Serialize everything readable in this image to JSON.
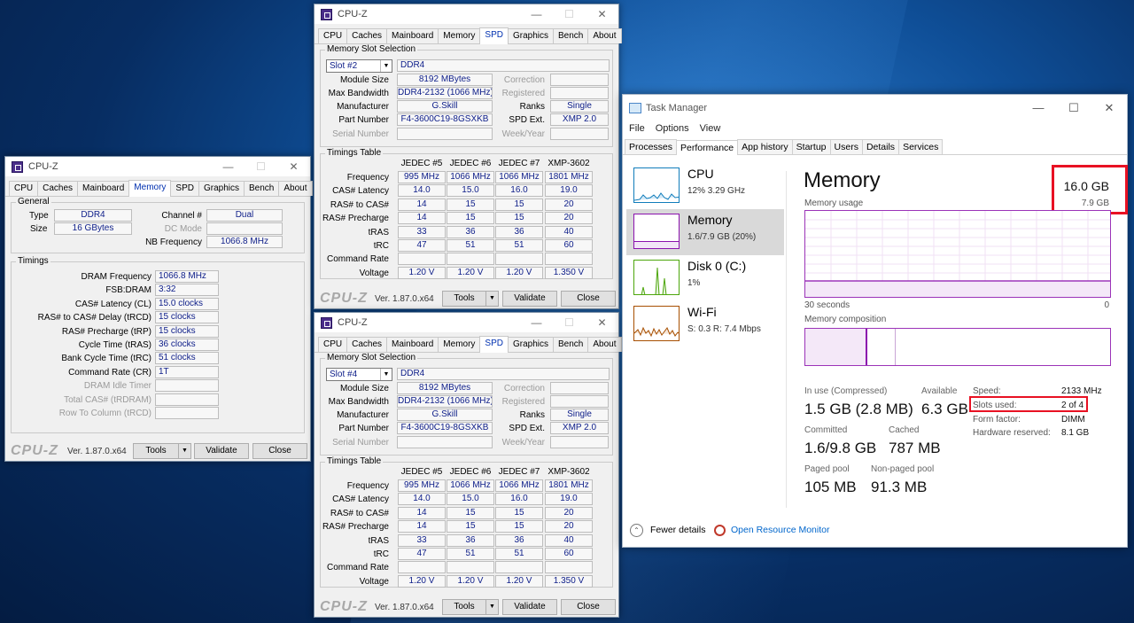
{
  "cpuz_common": {
    "title": "CPU-Z",
    "tabs": [
      "CPU",
      "Caches",
      "Mainboard",
      "Memory",
      "SPD",
      "Graphics",
      "Bench",
      "About"
    ],
    "logo": "CPU-Z",
    "version": "Ver. 1.87.0.x64",
    "tools_label": "Tools",
    "validate_label": "Validate",
    "close_label": "Close"
  },
  "memory_window": {
    "active_tab": "Memory",
    "general_title": "General",
    "type_label": "Type",
    "type_value": "DDR4",
    "size_label": "Size",
    "size_value": "16 GBytes",
    "channel_label": "Channel #",
    "channel_value": "Dual",
    "dc_mode_label": "DC Mode",
    "dc_mode_value": "",
    "nb_freq_label": "NB Frequency",
    "nb_freq_value": "1066.8 MHz",
    "timings_title": "Timings",
    "timings": [
      {
        "label": "DRAM Frequency",
        "value": "1066.8 MHz",
        "disabled": false
      },
      {
        "label": "FSB:DRAM",
        "value": "3:32",
        "disabled": false
      },
      {
        "label": "CAS# Latency (CL)",
        "value": "15.0 clocks",
        "disabled": false
      },
      {
        "label": "RAS# to CAS# Delay (tRCD)",
        "value": "15 clocks",
        "disabled": false
      },
      {
        "label": "RAS# Precharge (tRP)",
        "value": "15 clocks",
        "disabled": false
      },
      {
        "label": "Cycle Time (tRAS)",
        "value": "36 clocks",
        "disabled": false
      },
      {
        "label": "Bank Cycle Time (tRC)",
        "value": "51 clocks",
        "disabled": false
      },
      {
        "label": "Command Rate (CR)",
        "value": "1T",
        "disabled": false
      },
      {
        "label": "DRAM Idle Timer",
        "value": "",
        "disabled": true
      },
      {
        "label": "Total CAS# (tRDRAM)",
        "value": "",
        "disabled": true
      },
      {
        "label": "Row To Column (tRCD)",
        "value": "",
        "disabled": true
      }
    ]
  },
  "spd_windows": [
    {
      "active_tab": "SPD",
      "slot_group_title": "Memory Slot Selection",
      "slot": "Slot #2",
      "type": "DDR4",
      "module_size_label": "Module Size",
      "module_size": "8192 MBytes",
      "max_bw_label": "Max Bandwidth",
      "max_bw": "DDR4-2132 (1066 MHz)",
      "manufacturer_label": "Manufacturer",
      "manufacturer": "G.Skill",
      "part_label": "Part Number",
      "part": "F4-3600C19-8GSXKB",
      "serial_label": "Serial Number",
      "serial": "",
      "correction_label": "Correction",
      "correction": "",
      "registered_label": "Registered",
      "registered": "",
      "ranks_label": "Ranks",
      "ranks": "Single",
      "spd_ext_label": "SPD Ext.",
      "spd_ext": "XMP 2.0",
      "week_year_label": "Week/Year",
      "week_year": "",
      "timings_title": "Timings Table",
      "columns": [
        "JEDEC #5",
        "JEDEC #6",
        "JEDEC #7",
        "XMP-3602"
      ],
      "rows": [
        {
          "label": "Frequency",
          "values": [
            "995 MHz",
            "1066 MHz",
            "1066 MHz",
            "1801 MHz"
          ]
        },
        {
          "label": "CAS# Latency",
          "values": [
            "14.0",
            "15.0",
            "16.0",
            "19.0"
          ]
        },
        {
          "label": "RAS# to CAS#",
          "values": [
            "14",
            "15",
            "15",
            "20"
          ]
        },
        {
          "label": "RAS# Precharge",
          "values": [
            "14",
            "15",
            "15",
            "20"
          ]
        },
        {
          "label": "tRAS",
          "values": [
            "33",
            "36",
            "36",
            "40"
          ]
        },
        {
          "label": "tRC",
          "values": [
            "47",
            "51",
            "51",
            "60"
          ]
        },
        {
          "label": "Command Rate",
          "values": [
            "",
            "",
            "",
            ""
          ]
        },
        {
          "label": "Voltage",
          "values": [
            "1.20 V",
            "1.20 V",
            "1.20 V",
            "1.350 V"
          ]
        }
      ]
    },
    {
      "active_tab": "SPD",
      "slot_group_title": "Memory Slot Selection",
      "slot": "Slot #4",
      "type": "DDR4",
      "module_size_label": "Module Size",
      "module_size": "8192 MBytes",
      "max_bw_label": "Max Bandwidth",
      "max_bw": "DDR4-2132 (1066 MHz)",
      "manufacturer_label": "Manufacturer",
      "manufacturer": "G.Skill",
      "part_label": "Part Number",
      "part": "F4-3600C19-8GSXKB",
      "serial_label": "Serial Number",
      "serial": "",
      "correction_label": "Correction",
      "correction": "",
      "registered_label": "Registered",
      "registered": "",
      "ranks_label": "Ranks",
      "ranks": "Single",
      "spd_ext_label": "SPD Ext.",
      "spd_ext": "XMP 2.0",
      "week_year_label": "Week/Year",
      "week_year": "",
      "timings_title": "Timings Table",
      "columns": [
        "JEDEC #5",
        "JEDEC #6",
        "JEDEC #7",
        "XMP-3602"
      ],
      "rows": [
        {
          "label": "Frequency",
          "values": [
            "995 MHz",
            "1066 MHz",
            "1066 MHz",
            "1801 MHz"
          ]
        },
        {
          "label": "CAS# Latency",
          "values": [
            "14.0",
            "15.0",
            "16.0",
            "19.0"
          ]
        },
        {
          "label": "RAS# to CAS#",
          "values": [
            "14",
            "15",
            "15",
            "20"
          ]
        },
        {
          "label": "RAS# Precharge",
          "values": [
            "14",
            "15",
            "15",
            "20"
          ]
        },
        {
          "label": "tRAS",
          "values": [
            "33",
            "36",
            "36",
            "40"
          ]
        },
        {
          "label": "tRC",
          "values": [
            "47",
            "51",
            "51",
            "60"
          ]
        },
        {
          "label": "Command Rate",
          "values": [
            "",
            "",
            "",
            ""
          ]
        },
        {
          "label": "Voltage",
          "values": [
            "1.20 V",
            "1.20 V",
            "1.20 V",
            "1.350 V"
          ]
        }
      ]
    }
  ],
  "task_manager": {
    "title": "Task Manager",
    "menu": [
      "File",
      "Options",
      "View"
    ],
    "tabs": [
      "Processes",
      "Performance",
      "App history",
      "Startup",
      "Users",
      "Details",
      "Services"
    ],
    "active_tab": "Performance",
    "sidebar": [
      {
        "name": "CPU",
        "sub": "12%  3.29 GHz",
        "selected": false,
        "color": "#117dbb"
      },
      {
        "name": "Memory",
        "sub": "1.6/7.9 GB (20%)",
        "selected": true,
        "color": "#8b12ae"
      },
      {
        "name": "Disk 0 (C:)",
        "sub": "1%",
        "selected": false,
        "color": "#4da60c"
      },
      {
        "name": "Wi-Fi",
        "sub": "S: 0.3  R: 7.4 Mbps",
        "selected": false,
        "color": "#a74f01"
      }
    ],
    "heading": "Memory",
    "total": "16.0 GB",
    "usage_label": "Memory usage",
    "usage_max": "7.9 GB",
    "axis_left": "30 seconds",
    "axis_right": "0",
    "composition_label": "Memory composition",
    "stats": {
      "in_use_label": "In use (Compressed)",
      "in_use": "1.5 GB (2.8 MB)",
      "available_label": "Available",
      "available": "6.3 GB",
      "committed_label": "Committed",
      "committed": "1.6/9.8 GB",
      "cached_label": "Cached",
      "cached": "787 MB",
      "paged_label": "Paged pool",
      "paged": "105 MB",
      "nonpaged_label": "Non-paged pool",
      "nonpaged": "91.3 MB"
    },
    "props": [
      {
        "label": "Speed:",
        "value": "2133 MHz"
      },
      {
        "label": "Slots used:",
        "value": "2 of 4"
      },
      {
        "label": "Form factor:",
        "value": "DIMM"
      },
      {
        "label": "Hardware reserved:",
        "value": "8.1 GB"
      }
    ],
    "fewer_details": "Fewer details",
    "open_resource_monitor": "Open Resource Monitor",
    "highlight_color": "#e81123",
    "memory_color": "#8b12ae"
  }
}
